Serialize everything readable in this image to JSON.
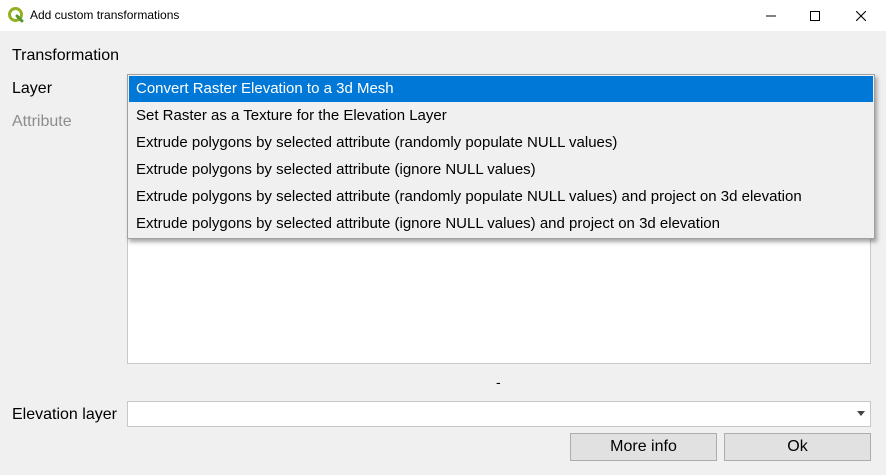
{
  "window": {
    "title": "Add custom transformations"
  },
  "form": {
    "transformation_label": "Transformation",
    "layer_label": "Layer",
    "attribute_label": "Attribute",
    "elevation_label": "Elevation layer",
    "elevation_value": "",
    "splitter_text": "-"
  },
  "dropdown": {
    "items": [
      {
        "label": "Convert Raster Elevation to a 3d Mesh",
        "selected": true
      },
      {
        "label": "Set Raster as a Texture for the Elevation Layer",
        "selected": false
      },
      {
        "label": "Extrude polygons by selected attribute (randomly populate NULL values)",
        "selected": false
      },
      {
        "label": "Extrude polygons by selected attribute (ignore NULL values)",
        "selected": false
      },
      {
        "label": "Extrude polygons by selected attribute (randomly populate  NULL values) and project on 3d elevation",
        "selected": false
      },
      {
        "label": "Extrude polygons by selected attribute (ignore NULL values) and project on 3d elevation",
        "selected": false
      }
    ]
  },
  "buttons": {
    "more_info": "More info",
    "ok": "Ok"
  },
  "icons": {
    "app": "qgis-logo-icon",
    "minimize": "minimize-icon",
    "maximize": "maximize-icon",
    "close": "close-icon",
    "dropdown_arrow": "chevron-down-icon"
  },
  "colors": {
    "selection": "#0078d7",
    "dialog_bg": "#f0f0f0",
    "qgis_green": "#93b023"
  }
}
